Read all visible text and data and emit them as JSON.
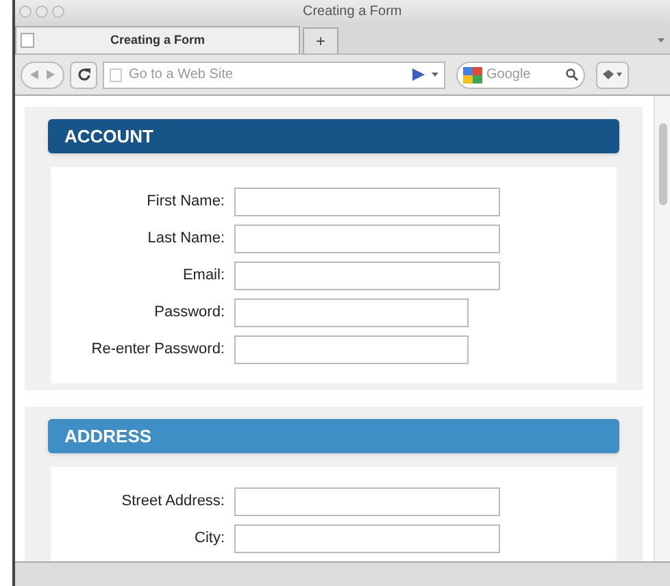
{
  "window": {
    "title": "Creating a Form"
  },
  "tabs": [
    {
      "label": "Creating a Form",
      "selected": true
    }
  ],
  "new_tab": "+",
  "address_bar": {
    "placeholder": "Go to a Web Site"
  },
  "search": {
    "placeholder": "Google"
  },
  "sections": [
    {
      "title": "ACCOUNT",
      "color": "#175589",
      "fields": [
        {
          "label": "First Name:",
          "kind": "text"
        },
        {
          "label": "Last Name:",
          "kind": "text"
        },
        {
          "label": "Email:",
          "kind": "text"
        },
        {
          "label": "Password:",
          "kind": "password"
        },
        {
          "label": "Re-enter Password:",
          "kind": "password"
        }
      ]
    },
    {
      "title": "ADDRESS",
      "color": "#3f8ec6",
      "fields": [
        {
          "label": "Street Address:",
          "kind": "text"
        },
        {
          "label": "City:",
          "kind": "text"
        }
      ]
    }
  ]
}
